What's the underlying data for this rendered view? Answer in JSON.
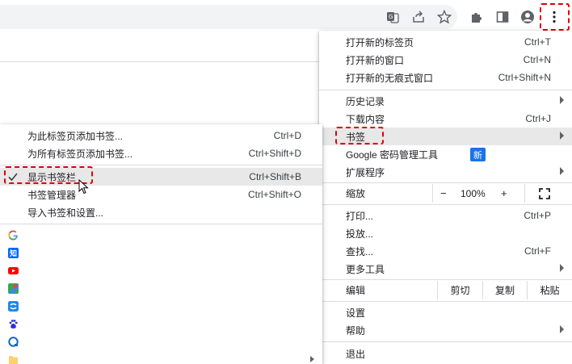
{
  "toolbar": {
    "icons": [
      "translate-icon",
      "share-icon",
      "star-icon",
      "extensions-icon",
      "sidepanel-icon",
      "profile-icon",
      "more-vert-icon"
    ]
  },
  "main_menu": {
    "new_tab": {
      "label": "打开新的标签页",
      "shortcut": "Ctrl+T"
    },
    "new_window": {
      "label": "打开新的窗口",
      "shortcut": "Ctrl+N"
    },
    "new_incognito": {
      "label": "打开新的无痕式窗口",
      "shortcut": "Ctrl+Shift+N"
    },
    "history": {
      "label": "历史记录"
    },
    "downloads": {
      "label": "下载内容",
      "shortcut": "Ctrl+J"
    },
    "bookmarks": {
      "label": "书签"
    },
    "password_manager": {
      "label": "Google 密码管理工具",
      "badge": "新"
    },
    "extensions": {
      "label": "扩展程序"
    },
    "zoom": {
      "label": "缩放",
      "minus": "−",
      "level": "100%",
      "plus": "+"
    },
    "print": {
      "label": "打印...",
      "shortcut": "Ctrl+P"
    },
    "cast": {
      "label": "投放..."
    },
    "find": {
      "label": "查找...",
      "shortcut": "Ctrl+F"
    },
    "more_tools": {
      "label": "更多工具"
    },
    "edit": {
      "label": "编辑",
      "cut": "剪切",
      "copy": "复制",
      "paste": "粘贴"
    },
    "settings": {
      "label": "设置"
    },
    "help": {
      "label": "帮助"
    },
    "exit": {
      "label": "退出"
    }
  },
  "bookmarks_menu": {
    "bookmark_tab": {
      "label": "为此标签页添加书签...",
      "shortcut": "Ctrl+D"
    },
    "bookmark_all": {
      "label": "为所有标签页添加书签...",
      "shortcut": "Ctrl+Shift+D"
    },
    "show_bar": {
      "label": "显示书签栏",
      "shortcut": "Ctrl+Shift+B"
    },
    "manager": {
      "label": "书签管理器",
      "shortcut": "Ctrl+Shift+O"
    },
    "import": {
      "label": "导入书签和设置..."
    },
    "favicons": [
      "google-favicon",
      "zhihu-favicon",
      "youtube-favicon",
      "maps-favicon",
      "app-favicon",
      "baidu-favicon",
      "site-favicon",
      "folder-icon"
    ],
    "zhihu_glyph": "知"
  },
  "colors": {
    "highlight": "#e8e8e8",
    "annotation": "#e00000",
    "badge": "#1a73e8"
  }
}
